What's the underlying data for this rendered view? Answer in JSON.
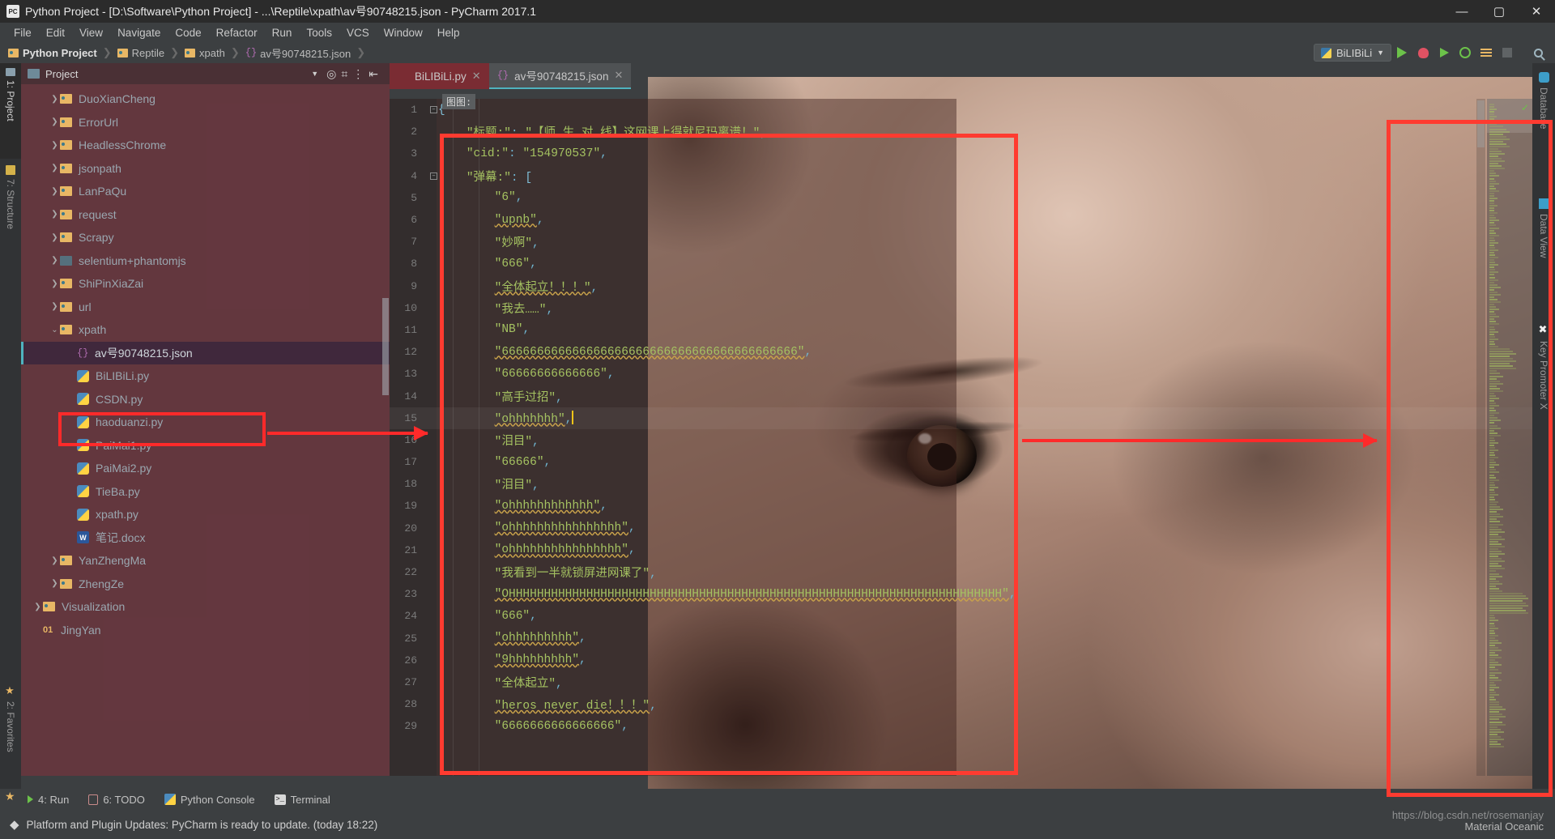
{
  "window": {
    "title": "Python Project - [D:\\Software\\Python Project] - ...\\Reptile\\xpath\\av号90748215.json - PyCharm 2017.1",
    "app_icon": "pycharm-icon",
    "minimize": "—",
    "maximize": "▢",
    "close": "✕"
  },
  "menu": {
    "items": [
      "File",
      "Edit",
      "View",
      "Navigate",
      "Code",
      "Refactor",
      "Run",
      "Tools",
      "VCS",
      "Window",
      "Help"
    ]
  },
  "breadcrumb": {
    "items": [
      {
        "label": "Python Project",
        "icon": "project-icon"
      },
      {
        "label": "Reptile",
        "icon": "folder-icon"
      },
      {
        "label": "xpath",
        "icon": "folder-icon"
      },
      {
        "label": "av号90748215.json",
        "icon": "json-icon"
      }
    ],
    "separator": "❯"
  },
  "toolbar": {
    "run_config": "BiLIBiLi",
    "dropdown_caret": "▼",
    "buttons": [
      "run-button",
      "debug-button",
      "run-coverage-button",
      "profile-button",
      "attach-button",
      "stop-button",
      "search-everywhere-button"
    ]
  },
  "left_tool_strip": {
    "items": [
      {
        "label": "1: Project",
        "icon": "project-tab-icon",
        "selected": true
      },
      {
        "label": "7: Structure",
        "icon": "structure-tab-icon",
        "selected": false
      },
      {
        "label": "2: Favorites",
        "icon": "favorites-tab-icon",
        "selected": false
      }
    ]
  },
  "right_tool_strip": {
    "items": [
      {
        "label": "Database",
        "icon": "database-icon"
      },
      {
        "label": "Data View",
        "icon": "grid-icon"
      },
      {
        "label": "Key Promoter X",
        "icon": "key-promoter-icon"
      }
    ]
  },
  "project_panel": {
    "header": "Project",
    "header_caret": "▼",
    "header_icons": [
      "target-icon",
      "collapse-icon",
      "options-icon",
      "hide-icon"
    ],
    "tree": [
      {
        "label": "DuoXianCheng",
        "type": "folder",
        "indent": 1,
        "twisty": "❯",
        "selected": false
      },
      {
        "label": "ErrorUrl",
        "type": "folder",
        "indent": 1,
        "twisty": "❯",
        "selected": false
      },
      {
        "label": "HeadlessChrome",
        "type": "folder",
        "indent": 1,
        "twisty": "❯",
        "selected": false
      },
      {
        "label": "jsonpath",
        "type": "folder",
        "indent": 1,
        "twisty": "❯",
        "selected": false
      },
      {
        "label": "LanPaQu",
        "type": "folder",
        "indent": 1,
        "twisty": "❯",
        "selected": false
      },
      {
        "label": "request",
        "type": "folder",
        "indent": 1,
        "twisty": "❯",
        "selected": false
      },
      {
        "label": "Scrapy",
        "type": "folder",
        "indent": 1,
        "twisty": "❯",
        "selected": false
      },
      {
        "label": "selentium+phantomjs",
        "type": "folder-plain",
        "indent": 1,
        "twisty": "❯",
        "selected": false
      },
      {
        "label": "ShiPinXiaZai",
        "type": "folder",
        "indent": 1,
        "twisty": "❯",
        "selected": false
      },
      {
        "label": "url",
        "type": "folder",
        "indent": 1,
        "twisty": "❯",
        "selected": false
      },
      {
        "label": "xpath",
        "type": "folder",
        "indent": 1,
        "twisty": "⌄",
        "selected": false
      },
      {
        "label": "av号90748215.json",
        "type": "json",
        "indent": 2,
        "twisty": "",
        "selected": true
      },
      {
        "label": "BiLIBiLi.py",
        "type": "python",
        "indent": 2,
        "twisty": "",
        "selected": false
      },
      {
        "label": "CSDN.py",
        "type": "python",
        "indent": 2,
        "twisty": "",
        "selected": false
      },
      {
        "label": "haoduanzi.py",
        "type": "python",
        "indent": 2,
        "twisty": "",
        "selected": false
      },
      {
        "label": "PaiMai1.py",
        "type": "python",
        "indent": 2,
        "twisty": "",
        "selected": false
      },
      {
        "label": "PaiMai2.py",
        "type": "python",
        "indent": 2,
        "twisty": "",
        "selected": false
      },
      {
        "label": "TieBa.py",
        "type": "python",
        "indent": 2,
        "twisty": "",
        "selected": false
      },
      {
        "label": "xpath.py",
        "type": "python",
        "indent": 2,
        "twisty": "",
        "selected": false
      },
      {
        "label": "笔记.docx",
        "type": "docx",
        "indent": 2,
        "twisty": "",
        "selected": false
      },
      {
        "label": "YanZhengMa",
        "type": "folder",
        "indent": 1,
        "twisty": "❯",
        "selected": false
      },
      {
        "label": "ZhengZe",
        "type": "folder",
        "indent": 1,
        "twisty": "❯",
        "selected": false
      },
      {
        "label": "Visualization",
        "type": "folder",
        "indent": 0,
        "twisty": "❯",
        "selected": false
      },
      {
        "label": "JingYan",
        "type": "module",
        "indent": 0,
        "twisty": "",
        "selected": false,
        "prefix": "01"
      }
    ]
  },
  "editor": {
    "tabs": [
      {
        "label": "BiLIBiLi.py",
        "icon": "python-icon",
        "close": "✕",
        "state": "modified"
      },
      {
        "label": "av号90748215.json",
        "icon": "json-icon",
        "close": "✕",
        "state": "active"
      }
    ],
    "breakpoint_tooltip": "图图:",
    "lines": [
      {
        "n": 1,
        "text": "{",
        "fold": true
      },
      {
        "n": 2,
        "text": "    \"标题:\": \"【师 生 对 线】这网课上得就尼玛离谱！\","
      },
      {
        "n": 3,
        "text": "    \"cid:\": \"154970537\","
      },
      {
        "n": 4,
        "text": "    \"弹幕:\": [",
        "fold": true
      },
      {
        "n": 5,
        "text": "        \"6\","
      },
      {
        "n": 6,
        "text": "        \"upnb\",",
        "squiggle": true
      },
      {
        "n": 7,
        "text": "        \"妙啊\","
      },
      {
        "n": 8,
        "text": "        \"666\","
      },
      {
        "n": 9,
        "text": "        \"全体起立！！！\",",
        "squiggle": true
      },
      {
        "n": 10,
        "text": "        \"我去……\","
      },
      {
        "n": 11,
        "text": "        \"NB\","
      },
      {
        "n": 12,
        "text": "        \"666666666666666666666666666666666666666666\",",
        "squiggle": true
      },
      {
        "n": 13,
        "text": "        \"66666666666666\","
      },
      {
        "n": 14,
        "text": "        \"高手过招\","
      },
      {
        "n": 15,
        "text": "        \"ohhhhhhh\",",
        "squiggle": true,
        "current": true,
        "caret": true
      },
      {
        "n": 16,
        "text": "        \"泪目\","
      },
      {
        "n": 17,
        "text": "        \"66666\","
      },
      {
        "n": 18,
        "text": "        \"泪目\","
      },
      {
        "n": 19,
        "text": "        \"ohhhhhhhhhhhh\",",
        "squiggle": true
      },
      {
        "n": 20,
        "text": "        \"ohhhhhhhhhhhhhhhh\",",
        "squiggle": true
      },
      {
        "n": 21,
        "text": "        \"ohhhhhhhhhhhhhhhh\",",
        "squiggle": true
      },
      {
        "n": 22,
        "text": "        \"我看到一半就锁屏进网课了\","
      },
      {
        "n": 23,
        "text": "        \"OHHHHHHHHHHHHHHHHHHHHHHHHHHHHHHHHHHHHHHHHHHHHHHHHHHHHHHHHHHHHHHHHHHHHHH\",",
        "squiggle": true
      },
      {
        "n": 24,
        "text": "        \"666\","
      },
      {
        "n": 25,
        "text": "        \"ohhhhhhhhh\",",
        "squiggle": true
      },
      {
        "n": 26,
        "text": "        \"9hhhhhhhhh\",",
        "squiggle": true
      },
      {
        "n": 27,
        "text": "        \"全体起立\","
      },
      {
        "n": 28,
        "text": "        \"heros never die！！！\",",
        "squiggle": true
      },
      {
        "n": 29,
        "text": "        \"6666666666666666\","
      }
    ],
    "minimap_check": "✓"
  },
  "bottom_bar": {
    "items": [
      {
        "label": "4: Run",
        "icon": "run-icon",
        "mnemonic": "4"
      },
      {
        "label": "6: TODO",
        "icon": "todo-icon",
        "mnemonic": "6"
      },
      {
        "label": "Python Console",
        "icon": "python-console-icon",
        "mnemonic": ""
      },
      {
        "label": "Terminal",
        "icon": "terminal-icon",
        "mnemonic": ""
      }
    ]
  },
  "status_bar": {
    "icon": "update-icon",
    "message": "Platform and Plugin Updates: PyCharm is ready to update. (today 18:22)"
  },
  "watermarks": {
    "theme": "Material Oceanic",
    "url": "https://blog.csdn.net/rosemanjay"
  },
  "colors": {
    "annotation_red": "#ff2a2a",
    "accent_cyan": "#4fb3bf",
    "string_green": "#a5c261",
    "punct_blue": "#6fb4d0",
    "panel_bg": "#3c3f41",
    "titlebar_bg": "#2b2b2b",
    "tint_red": "rgba(124,50,62,0.62)"
  }
}
